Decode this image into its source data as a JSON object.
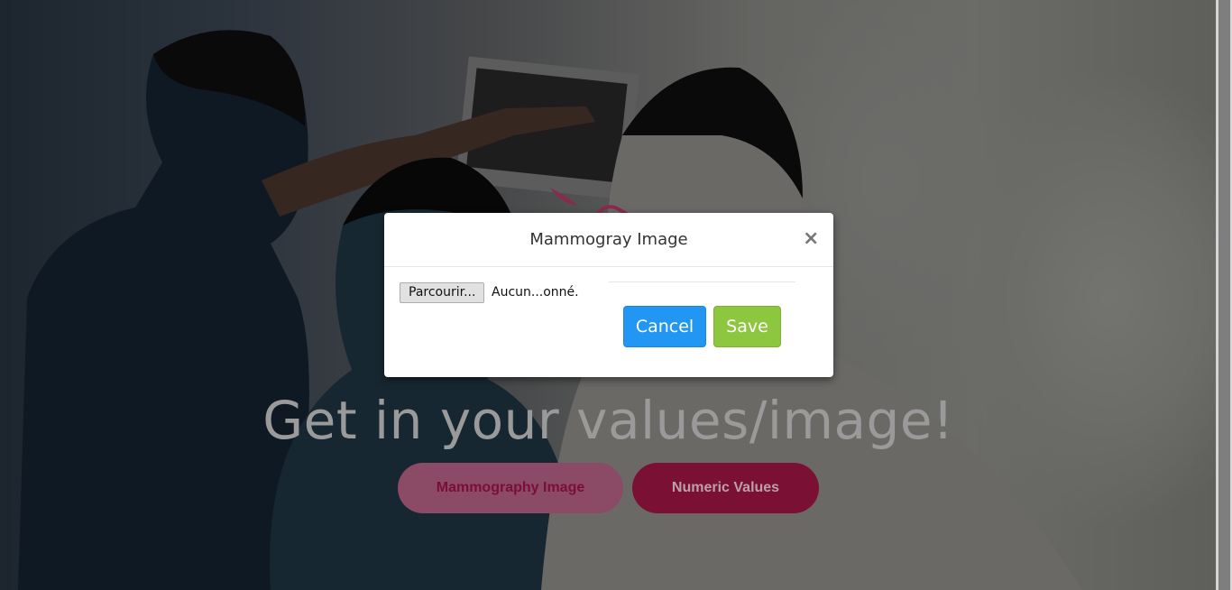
{
  "hero": {
    "heading": "Get in your values/image!",
    "buttons": {
      "mammography_image": "Mammography Image",
      "numeric_values": "Numeric Values"
    }
  },
  "modal": {
    "title": "Mammogray Image",
    "close_symbol": "×",
    "file_input": {
      "browse_label": "Parcourir...",
      "status_text": "Aucun...onné."
    },
    "actions": {
      "cancel_label": "Cancel",
      "save_label": "Save"
    }
  },
  "colors": {
    "cancel_button": "#2196f3",
    "save_button": "#8dc63f",
    "brand_accent": "#7a1134",
    "brand_accent_light": "#8b4a66"
  },
  "icons": {
    "close": "close-icon",
    "logo": "ribbon-logo-icon"
  }
}
